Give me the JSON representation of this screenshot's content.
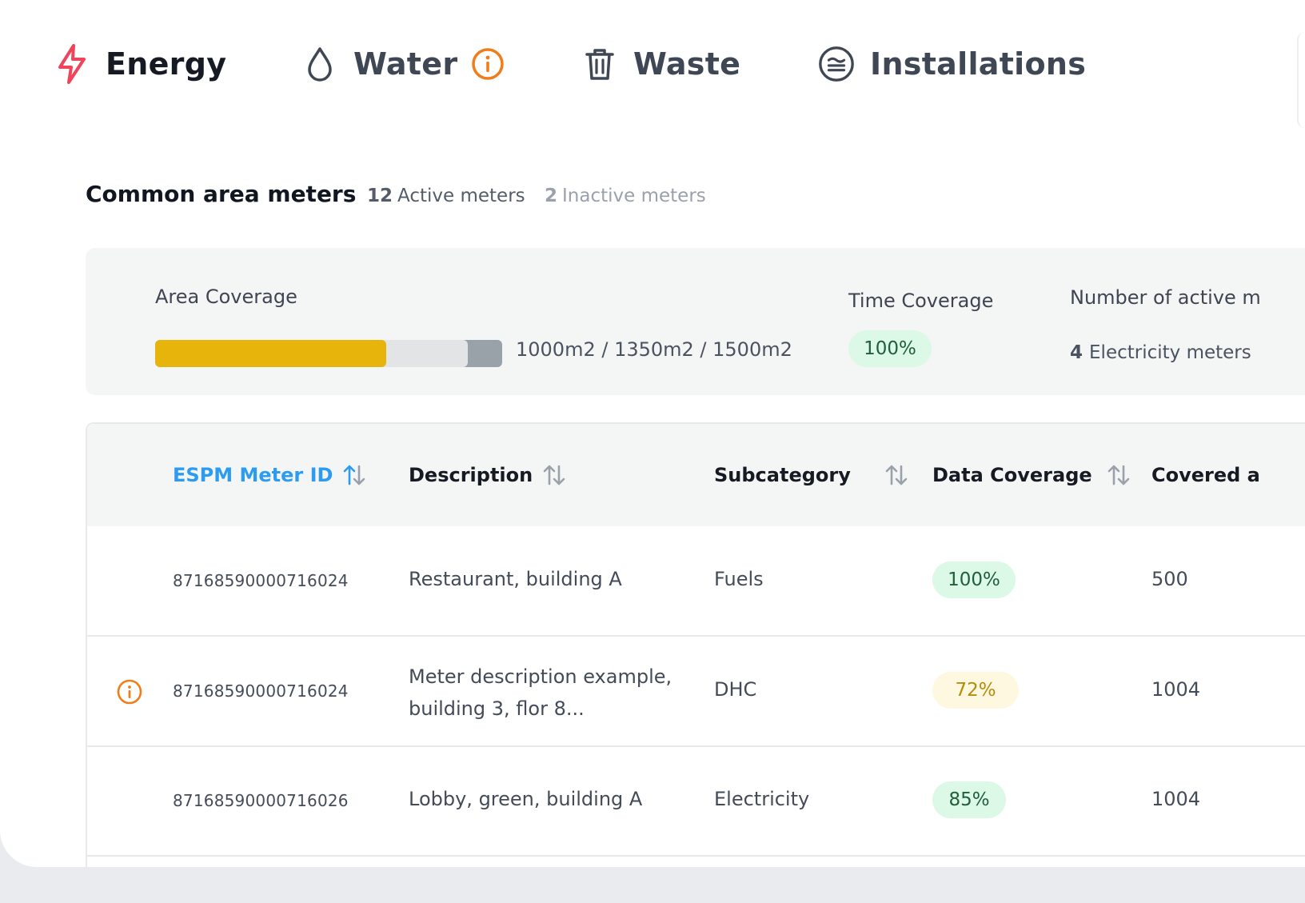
{
  "tabs": [
    {
      "label": "Energy",
      "icon": "lightning-icon",
      "active": true
    },
    {
      "label": "Water",
      "icon": "water-drop-icon",
      "has_info": true
    },
    {
      "label": "Waste",
      "icon": "trash-icon"
    },
    {
      "label": "Installations",
      "icon": "installations-icon"
    }
  ],
  "section": {
    "title": "Common area meters",
    "active_count": "12",
    "active_label": "Active meters",
    "inactive_count": "2",
    "inactive_label": "Inactive meters"
  },
  "summary": {
    "area_label": "Area Coverage",
    "area_values": "1000m2 / 1350m2  / 1500m2",
    "area_progress": {
      "covered_fraction": 0.667,
      "partial_fraction": 0.9
    },
    "time_label": "Time Coverage",
    "time_value": "100%",
    "num_label": "Number of active m",
    "electricity_count": "4",
    "electricity_label": "Electricity meters"
  },
  "table": {
    "columns": [
      "ESPM Meter ID",
      "Description",
      "Subcategory",
      "Data Coverage",
      "Covered a"
    ],
    "rows": [
      {
        "id": "87168590000716024",
        "description": "Restaurant, building A",
        "subcategory": "Fuels",
        "coverage": "100%",
        "coverage_status": "good",
        "covered": "500",
        "warning": false
      },
      {
        "id": "87168590000716024",
        "description": "Meter description example, building 3, flor 8...",
        "subcategory": "DHC",
        "coverage": "72%",
        "coverage_status": "partial",
        "covered": "1004",
        "warning": true
      },
      {
        "id": "87168590000716026",
        "description": "Lobby, green, building A",
        "subcategory": "Electricity",
        "coverage": "85%",
        "coverage_status": "good",
        "covered": "1004",
        "warning": false
      }
    ]
  },
  "colors": {
    "accent_blue": "#2d9bf0",
    "energy_red": "#f0445a",
    "warning_orange": "#f07d1a",
    "progress_yellow": "#e6b40a",
    "badge_green_bg": "#dcf8e6",
    "badge_yellow_bg": "#fdf8df"
  }
}
